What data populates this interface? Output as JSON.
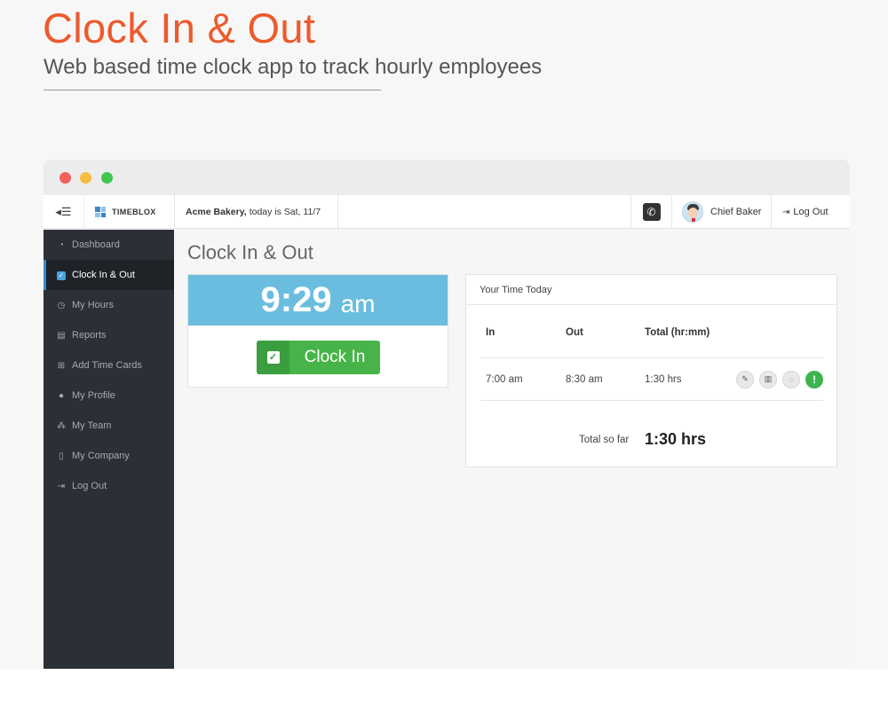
{
  "hero": {
    "title": "Clock In & Out",
    "subtitle": "Web based time clock app to track hourly employees"
  },
  "topbar": {
    "toggle_icon": "menu-collapse-icon",
    "logo_text": "TIMEBLOX",
    "company_name": "Acme Bakery,",
    "date_text": "today is Sat, 11/7",
    "phone_icon": "phone-icon",
    "user_name": "Chief Baker",
    "logout_label": "Log Out"
  },
  "sidebar": {
    "items": [
      {
        "label": "Dashboard",
        "icon": "dashboard-icon",
        "glyph": "◔",
        "active": false
      },
      {
        "label": "Clock In & Out",
        "icon": "checkbox-icon",
        "glyph": "✓",
        "active": true
      },
      {
        "label": "My Hours",
        "icon": "clock-icon",
        "glyph": "◷",
        "active": false
      },
      {
        "label": "Reports",
        "icon": "reports-icon",
        "glyph": "▤",
        "active": false
      },
      {
        "label": "Add Time Cards",
        "icon": "plus-square-icon",
        "glyph": "⊞",
        "active": false
      },
      {
        "label": "My Profile",
        "icon": "user-icon",
        "glyph": "●",
        "active": false
      },
      {
        "label": "My Team",
        "icon": "sitemap-icon",
        "glyph": "⁂",
        "active": false
      },
      {
        "label": "My Company",
        "icon": "building-icon",
        "glyph": "▯",
        "active": false
      },
      {
        "label": "Log Out",
        "icon": "sign-out-icon",
        "glyph": "⇥",
        "active": false
      }
    ]
  },
  "main": {
    "page_title": "Clock In & Out",
    "clock": {
      "time": "9:29",
      "ampm": "am",
      "button_label": "Clock In"
    },
    "time_today": {
      "header": "Your Time Today",
      "columns": [
        "In",
        "Out",
        "Total (hr:mm)"
      ],
      "rows": [
        {
          "in": "7:00 am",
          "out": "8:30 am",
          "total": "1:30 hrs"
        }
      ],
      "total_label": "Total so far",
      "total_value": "1:30 hrs"
    }
  },
  "colors": {
    "accent": "#ee5a2d",
    "clock_header": "#6bbddf",
    "clock_button": "#46b449",
    "sidebar_bg": "#2b2f36"
  }
}
